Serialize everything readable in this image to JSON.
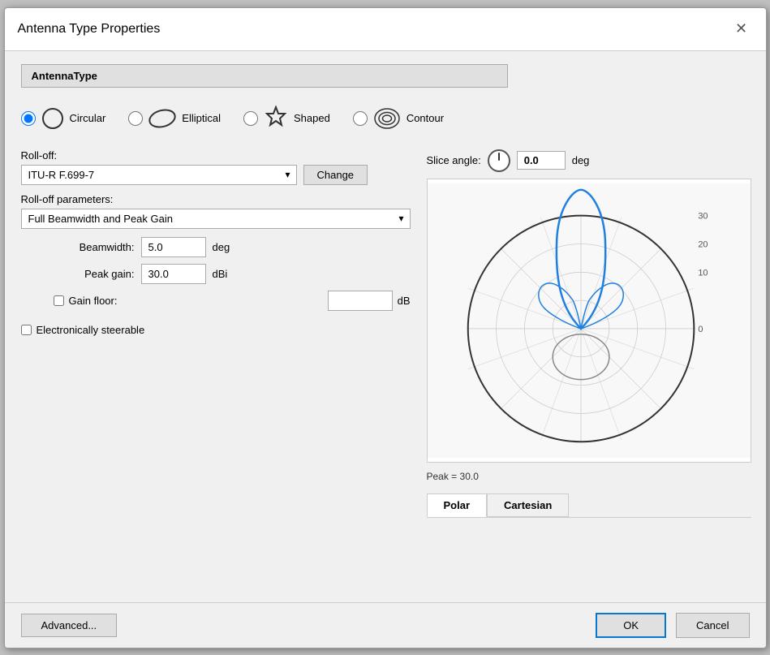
{
  "dialog": {
    "title": "Antenna Type Properties",
    "close_label": "✕"
  },
  "antenna_type": {
    "label": "AntennaType"
  },
  "radio_options": [
    {
      "id": "circular",
      "label": "Circular",
      "selected": true
    },
    {
      "id": "elliptical",
      "label": "Elliptical",
      "selected": false
    },
    {
      "id": "shaped",
      "label": "Shaped",
      "selected": false
    },
    {
      "id": "contour",
      "label": "Contour",
      "selected": false
    }
  ],
  "rolloff": {
    "label": "Roll-off:",
    "value": "ITU-R F.699-7",
    "change_btn": "Change"
  },
  "rolloff_params": {
    "label": "Roll-off parameters:",
    "value": "Full Beamwidth and Peak Gain"
  },
  "params": {
    "beamwidth": {
      "label": "Beamwidth:",
      "value": "5.0",
      "unit": "deg"
    },
    "peak_gain": {
      "label": "Peak gain:",
      "value": "30.0",
      "unit": "dBi"
    },
    "gain_floor": {
      "label": "Gain floor:",
      "value": "",
      "unit": "dB",
      "checked": false
    }
  },
  "electronically_steerable": {
    "label": "Electronically steerable",
    "checked": false
  },
  "slice_angle": {
    "label": "Slice angle:",
    "value": "0.0",
    "unit": "deg"
  },
  "chart": {
    "peak_label": "Peak = 30.0",
    "db_labels": [
      "30",
      "20",
      "10",
      "0"
    ],
    "tabs": [
      {
        "label": "Polar",
        "active": true
      },
      {
        "label": "Cartesian",
        "active": false
      }
    ]
  },
  "buttons": {
    "advanced": "Advanced...",
    "ok": "OK",
    "cancel": "Cancel"
  }
}
